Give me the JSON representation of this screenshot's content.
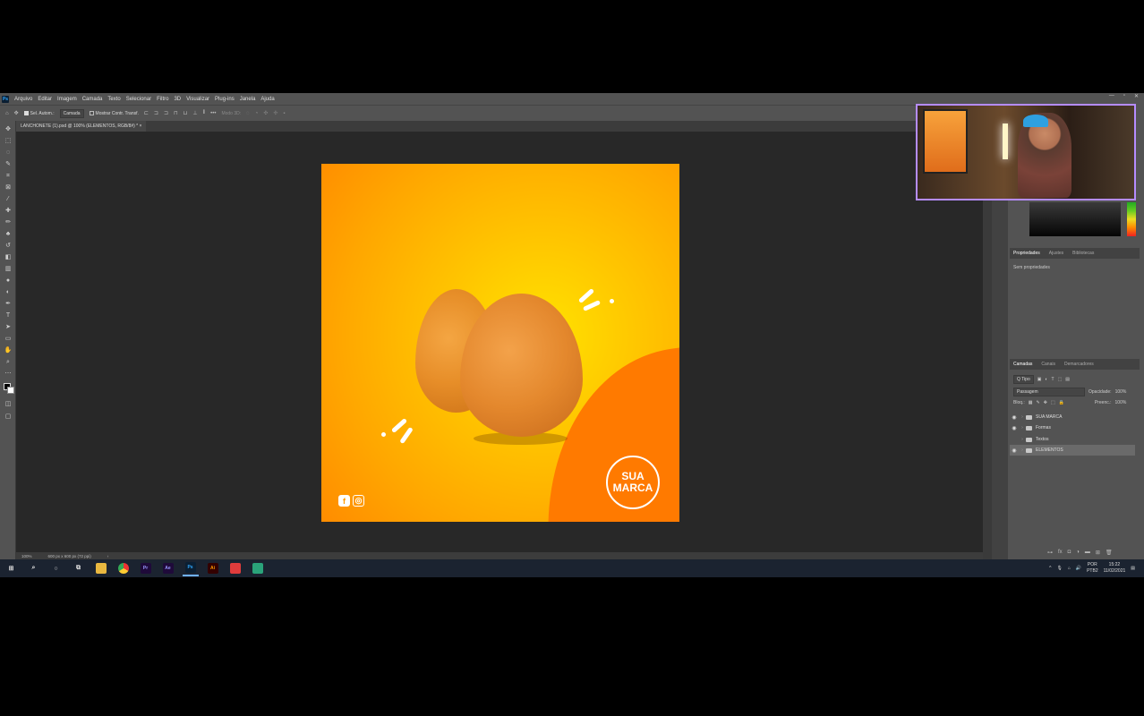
{
  "app": {
    "logo": "Ps",
    "menu": [
      "Arquivo",
      "Editar",
      "Imagem",
      "Camada",
      "Texto",
      "Selecionar",
      "Filtro",
      "3D",
      "Visualizar",
      "Plug-ins",
      "Janela",
      "Ajuda"
    ],
    "window_controls": [
      "—",
      "▫",
      "✕"
    ]
  },
  "options": {
    "auto_select_label": "Sel. Autom.:",
    "auto_select_value": "Camada",
    "show_transform_label": "Mostrar Contr. Transf.",
    "mode_3d_label": "Modo 3D:",
    "more": "•••"
  },
  "document": {
    "tab_title": "LANCHONETE (1).psd @ 100% (ELEMENTOS, RGB/8#) *",
    "tab_close": "×"
  },
  "status": {
    "zoom": "100%",
    "dimensions": "600 px x 600 px (72 ppi)",
    "arrow": "›"
  },
  "artwork": {
    "brand_line1": "SUA",
    "brand_line2": "MARCA",
    "facebook_glyph": "f",
    "instagram_glyph": "◎"
  },
  "properties": {
    "tabs": [
      "Propriedades",
      "Ajustes",
      "Bibliotecas"
    ],
    "body_text": "Sem propriedades"
  },
  "layers_panel": {
    "tabs": [
      "Camadas",
      "Canais",
      "Demarcadores"
    ],
    "filter_label": "Q Tipo",
    "blend_mode": "Passagem",
    "opacity_label": "Opacidade:",
    "opacity_value": "100%",
    "lock_label": "Bloq.:",
    "fill_label": "Preenc.:",
    "fill_value": "100%",
    "layers": [
      {
        "name": "SUA MARCA",
        "visible": true,
        "selected": false
      },
      {
        "name": "Formas",
        "visible": true,
        "selected": false
      },
      {
        "name": "Textos",
        "visible": false,
        "selected": false
      },
      {
        "name": "ELEMENTOS",
        "visible": true,
        "selected": true
      }
    ]
  },
  "taskbar": {
    "apps": [
      "Pr",
      "Ae",
      "Ps",
      "Ai"
    ],
    "lang_line1": "POR",
    "lang_line2": "PTB2",
    "time": "15:22",
    "date": "11/02/2021"
  }
}
